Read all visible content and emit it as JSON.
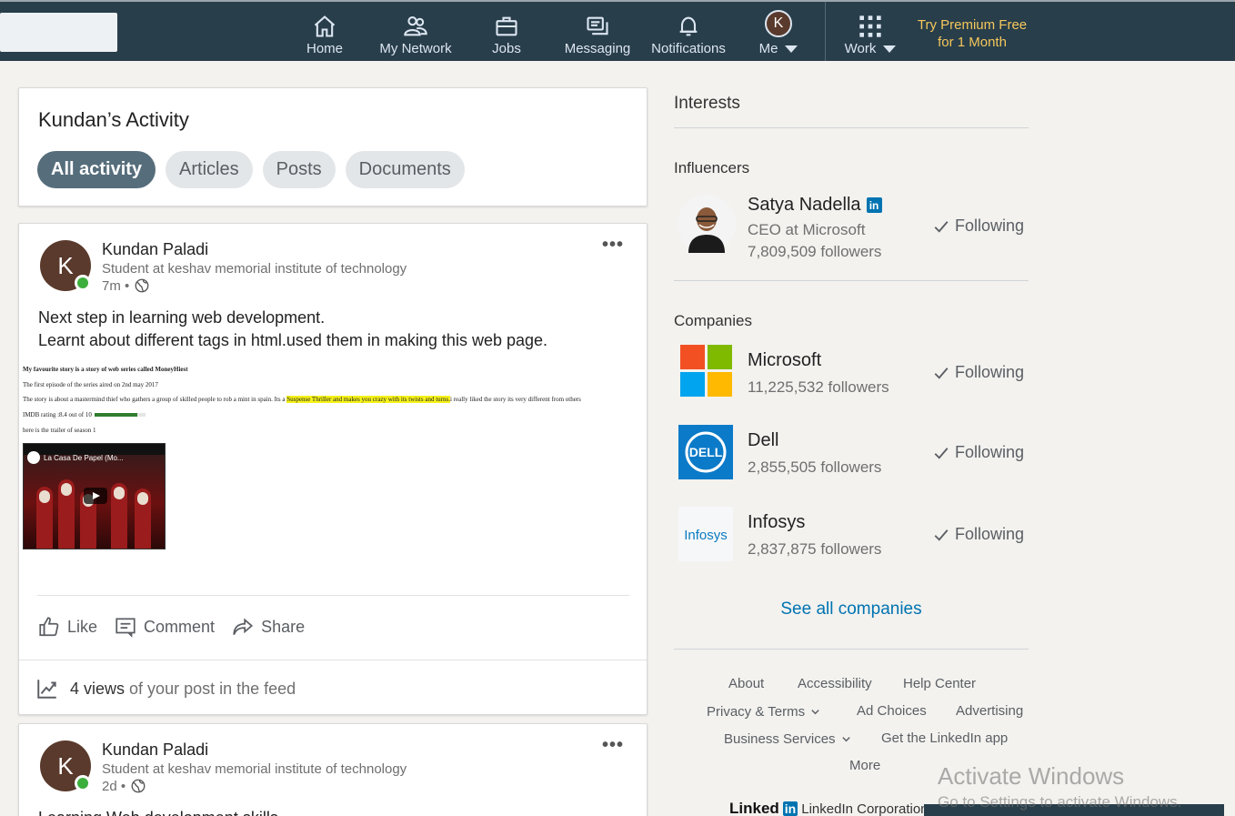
{
  "nav": {
    "items": [
      {
        "label": "Home",
        "icon": "home-icon"
      },
      {
        "label": "My Network",
        "icon": "network-icon"
      },
      {
        "label": "Jobs",
        "icon": "briefcase-icon"
      },
      {
        "label": "Messaging",
        "icon": "messaging-icon"
      },
      {
        "label": "Notifications",
        "icon": "bell-icon"
      },
      {
        "label": "Me",
        "avatar_letter": "K"
      },
      {
        "label": "Work",
        "icon": "grid-icon"
      }
    ],
    "premium": "Try Premium Free for 1 Month",
    "colors": {
      "bar": "#283e4a",
      "premium": "#f5c75d"
    }
  },
  "activity": {
    "title": "Kundan’s Activity",
    "filters": [
      "All activity",
      "Articles",
      "Posts",
      "Documents"
    ],
    "active_filter": "All activity"
  },
  "post": {
    "author_initial": "K",
    "author": "Kundan Paladi",
    "headline": "Student at keshav memorial institute of technology",
    "time": "7m •",
    "text_line1": "Next step in learning web development.",
    "text_line2": "Learnt about different tags in html.used them in making this web page.",
    "embed": {
      "heading": "My favourite story is a story of web series called MoneyHiest",
      "line1": "The first episode of the series aired on 2nd may 2017",
      "line2_before": "The story is about a mastermind thief who gathers a group of skilled people to rob a mint in spain. Its a ",
      "line2_highlight": "Suspense Thriller and makes you crazy with its twists and turns.",
      "line2_after": "i really liked the story its very different from others",
      "rating_label": "IMDB rating :8.4 out of 10",
      "rating_fraction": 0.84,
      "trailer_label": "here is the trailer of season 1",
      "video_title": "La Casa De Papel (Mo..."
    },
    "actions": {
      "like": "Like",
      "comment": "Comment",
      "share": "Share"
    },
    "views_count": "4 views",
    "views_suffix": "of your post in the feed"
  },
  "post2": {
    "author_initial": "K",
    "author": "Kundan Paladi",
    "headline": "Student at keshav memorial institute of technology",
    "time": "2d •",
    "text_line1": "Learning Web development skills"
  },
  "interests": {
    "title": "Interests",
    "influencers_title": "Influencers",
    "influencer": {
      "name": "Satya Nadella",
      "title": "CEO at Microsoft",
      "followers": "7,809,509 followers",
      "status": "Following"
    },
    "companies_title": "Companies",
    "companies": [
      {
        "name": "Microsoft",
        "followers": "11,225,532 followers",
        "status": "Following"
      },
      {
        "name": "Dell",
        "followers": "2,855,505 followers",
        "status": "Following",
        "logo_text": "DELL"
      },
      {
        "name": "Infosys",
        "followers": "2,837,875 followers",
        "status": "Following",
        "logo_text": "Infosys"
      }
    ],
    "see_all": "See all companies"
  },
  "footer": {
    "about": "About",
    "accessibility": "Accessibility",
    "help_center": "Help Center",
    "privacy_terms": "Privacy & Terms",
    "ad_choices": "Ad Choices",
    "advertising": "Advertising",
    "business_services": "Business Services",
    "get_app": "Get the LinkedIn app",
    "more": "More",
    "brand_word": "Linked",
    "brand_in": "in",
    "corporation": "LinkedIn Corporation"
  },
  "windows": {
    "title": "Activate Windows",
    "subtitle": "Go to Settings to activate Windows."
  }
}
